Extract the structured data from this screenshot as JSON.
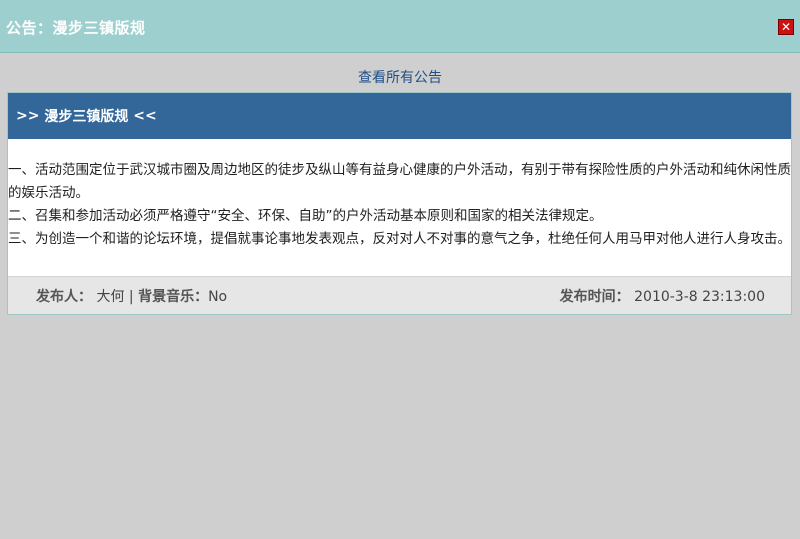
{
  "window": {
    "title": "公告：漫步三镇版规",
    "close_glyph": "✕"
  },
  "view_all_link": "查看所有公告",
  "notice": {
    "header_prefix": ">> ",
    "title": "漫步三镇版规",
    "header_suffix": " <<",
    "paragraphs": [
      "一、活动范围定位于武汉城市圈及周边地区的徒步及纵山等有益身心健康的户外活动，有别于带有探险性质的户外活动和纯休闲性质的娱乐活动。",
      "二、召集和参加活动必须严格遵守“安全、环保、自助”的户外活动基本原则和国家的相关法律规定。",
      "三、为创造一个和谐的论坛环境，提倡就事论事地发表观点，反对对人不对事的意气之争，杜绝任何人用马甲对他人进行人身攻击。"
    ],
    "footer": {
      "publisher_label": "发布人：",
      "publisher": "大何",
      "separator": "|",
      "music_label": "背景音乐：",
      "music": "No",
      "time_label": "发布时间：",
      "time": "2010-3-8 23:13:00"
    }
  },
  "colors": {
    "title_bar": "#9dcfcf",
    "panel_header": "#336699",
    "link": "#1f4f86",
    "close": "#cc1111"
  }
}
